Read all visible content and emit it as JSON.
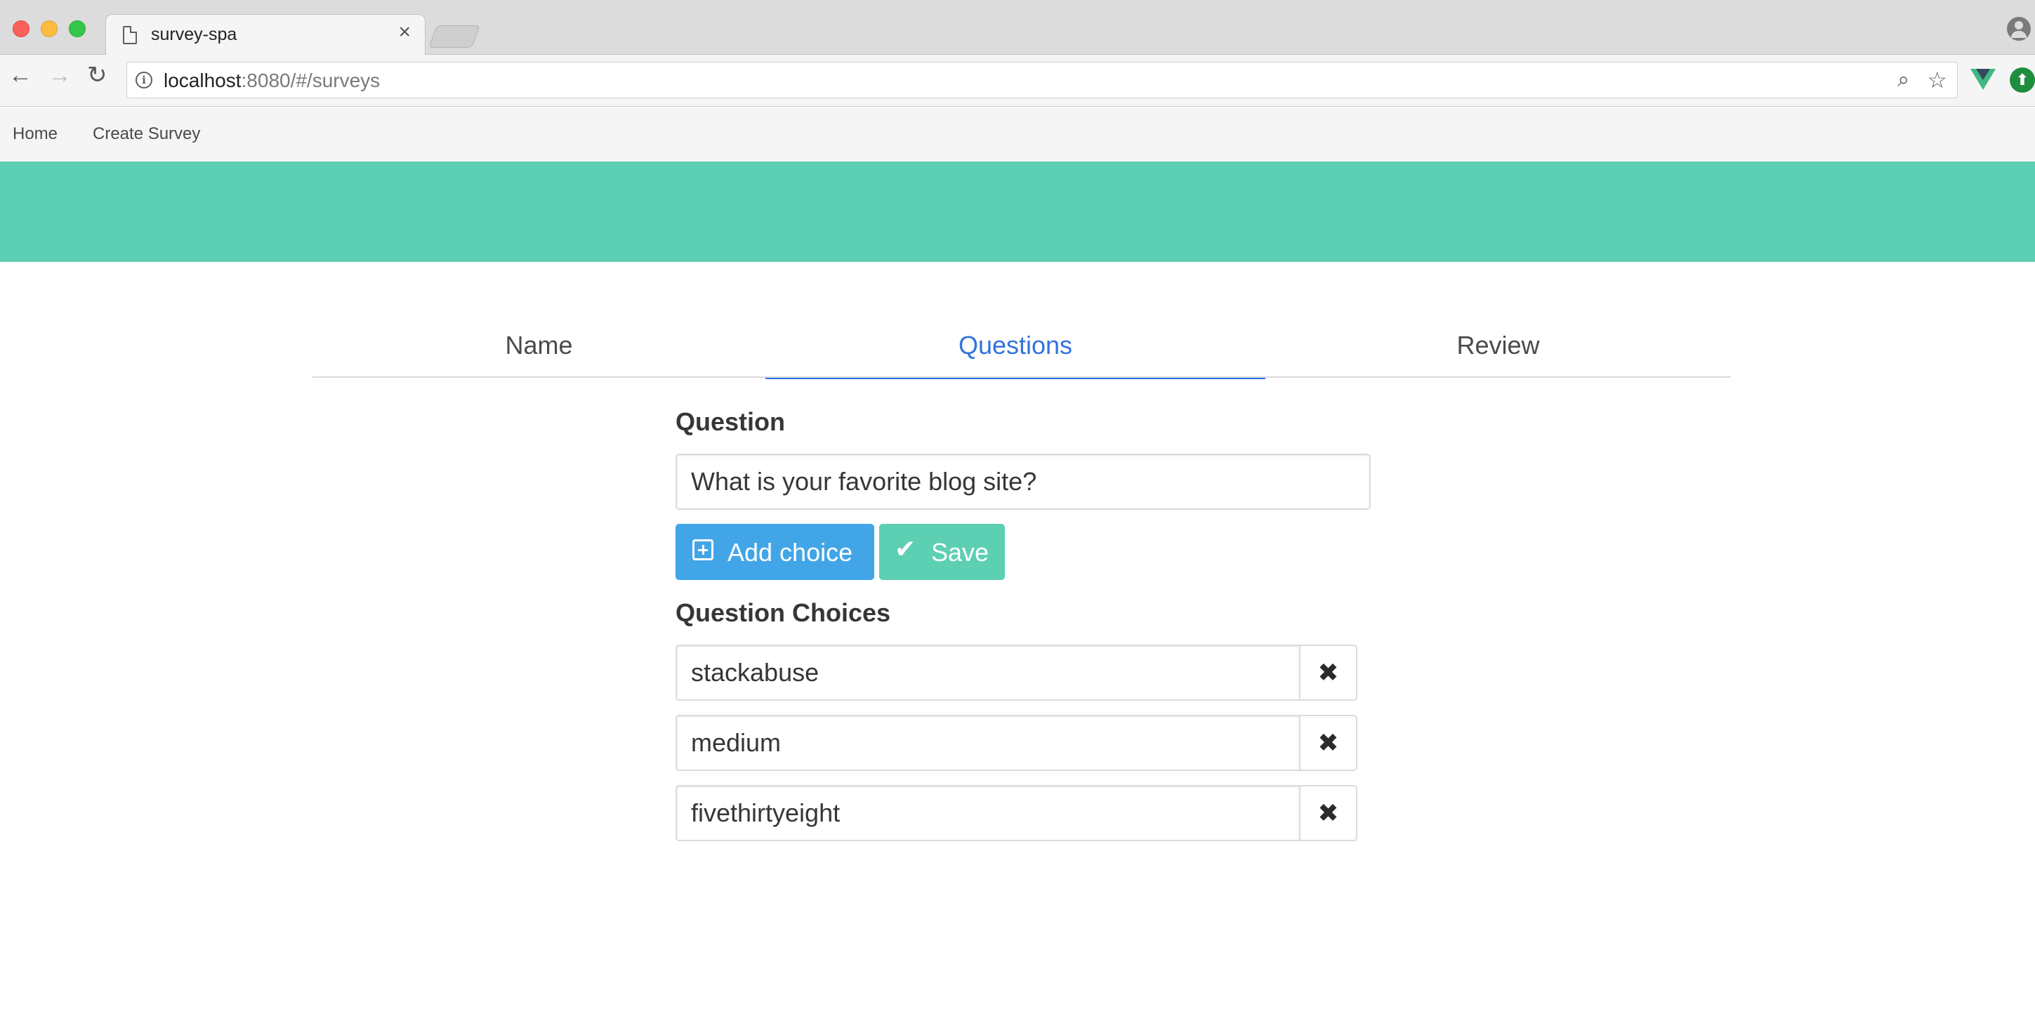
{
  "browser": {
    "tab_title": "survey-spa",
    "tab_close": "×",
    "url_host": "localhost",
    "url_path": ":8080/#/surveys",
    "back_glyph": "←",
    "forward_glyph": "→",
    "reload_glyph": "↻",
    "info_glyph": "i",
    "zoom_glyph": "⌕",
    "star_glyph": "☆"
  },
  "nav": {
    "home": "Home",
    "create_survey": "Create Survey"
  },
  "colors": {
    "hero": "#5dcfb3",
    "active_tab": "#3273dc",
    "add_button": "#42a5e8",
    "save_button": "#5dcfb3"
  },
  "steps": {
    "name": "Name",
    "questions": "Questions",
    "review": "Review",
    "active": "Questions"
  },
  "form": {
    "question_label": "Question",
    "question_value": "What is your favorite blog site?",
    "add_choice_label": "Add choice",
    "save_label": "Save",
    "add_icon": "plus-square-icon",
    "save_icon": "check-icon",
    "choices_label": "Question Choices",
    "remove_glyph": "✖",
    "choices": [
      "stackabuse",
      "medium",
      "fivethirtyeight"
    ]
  }
}
